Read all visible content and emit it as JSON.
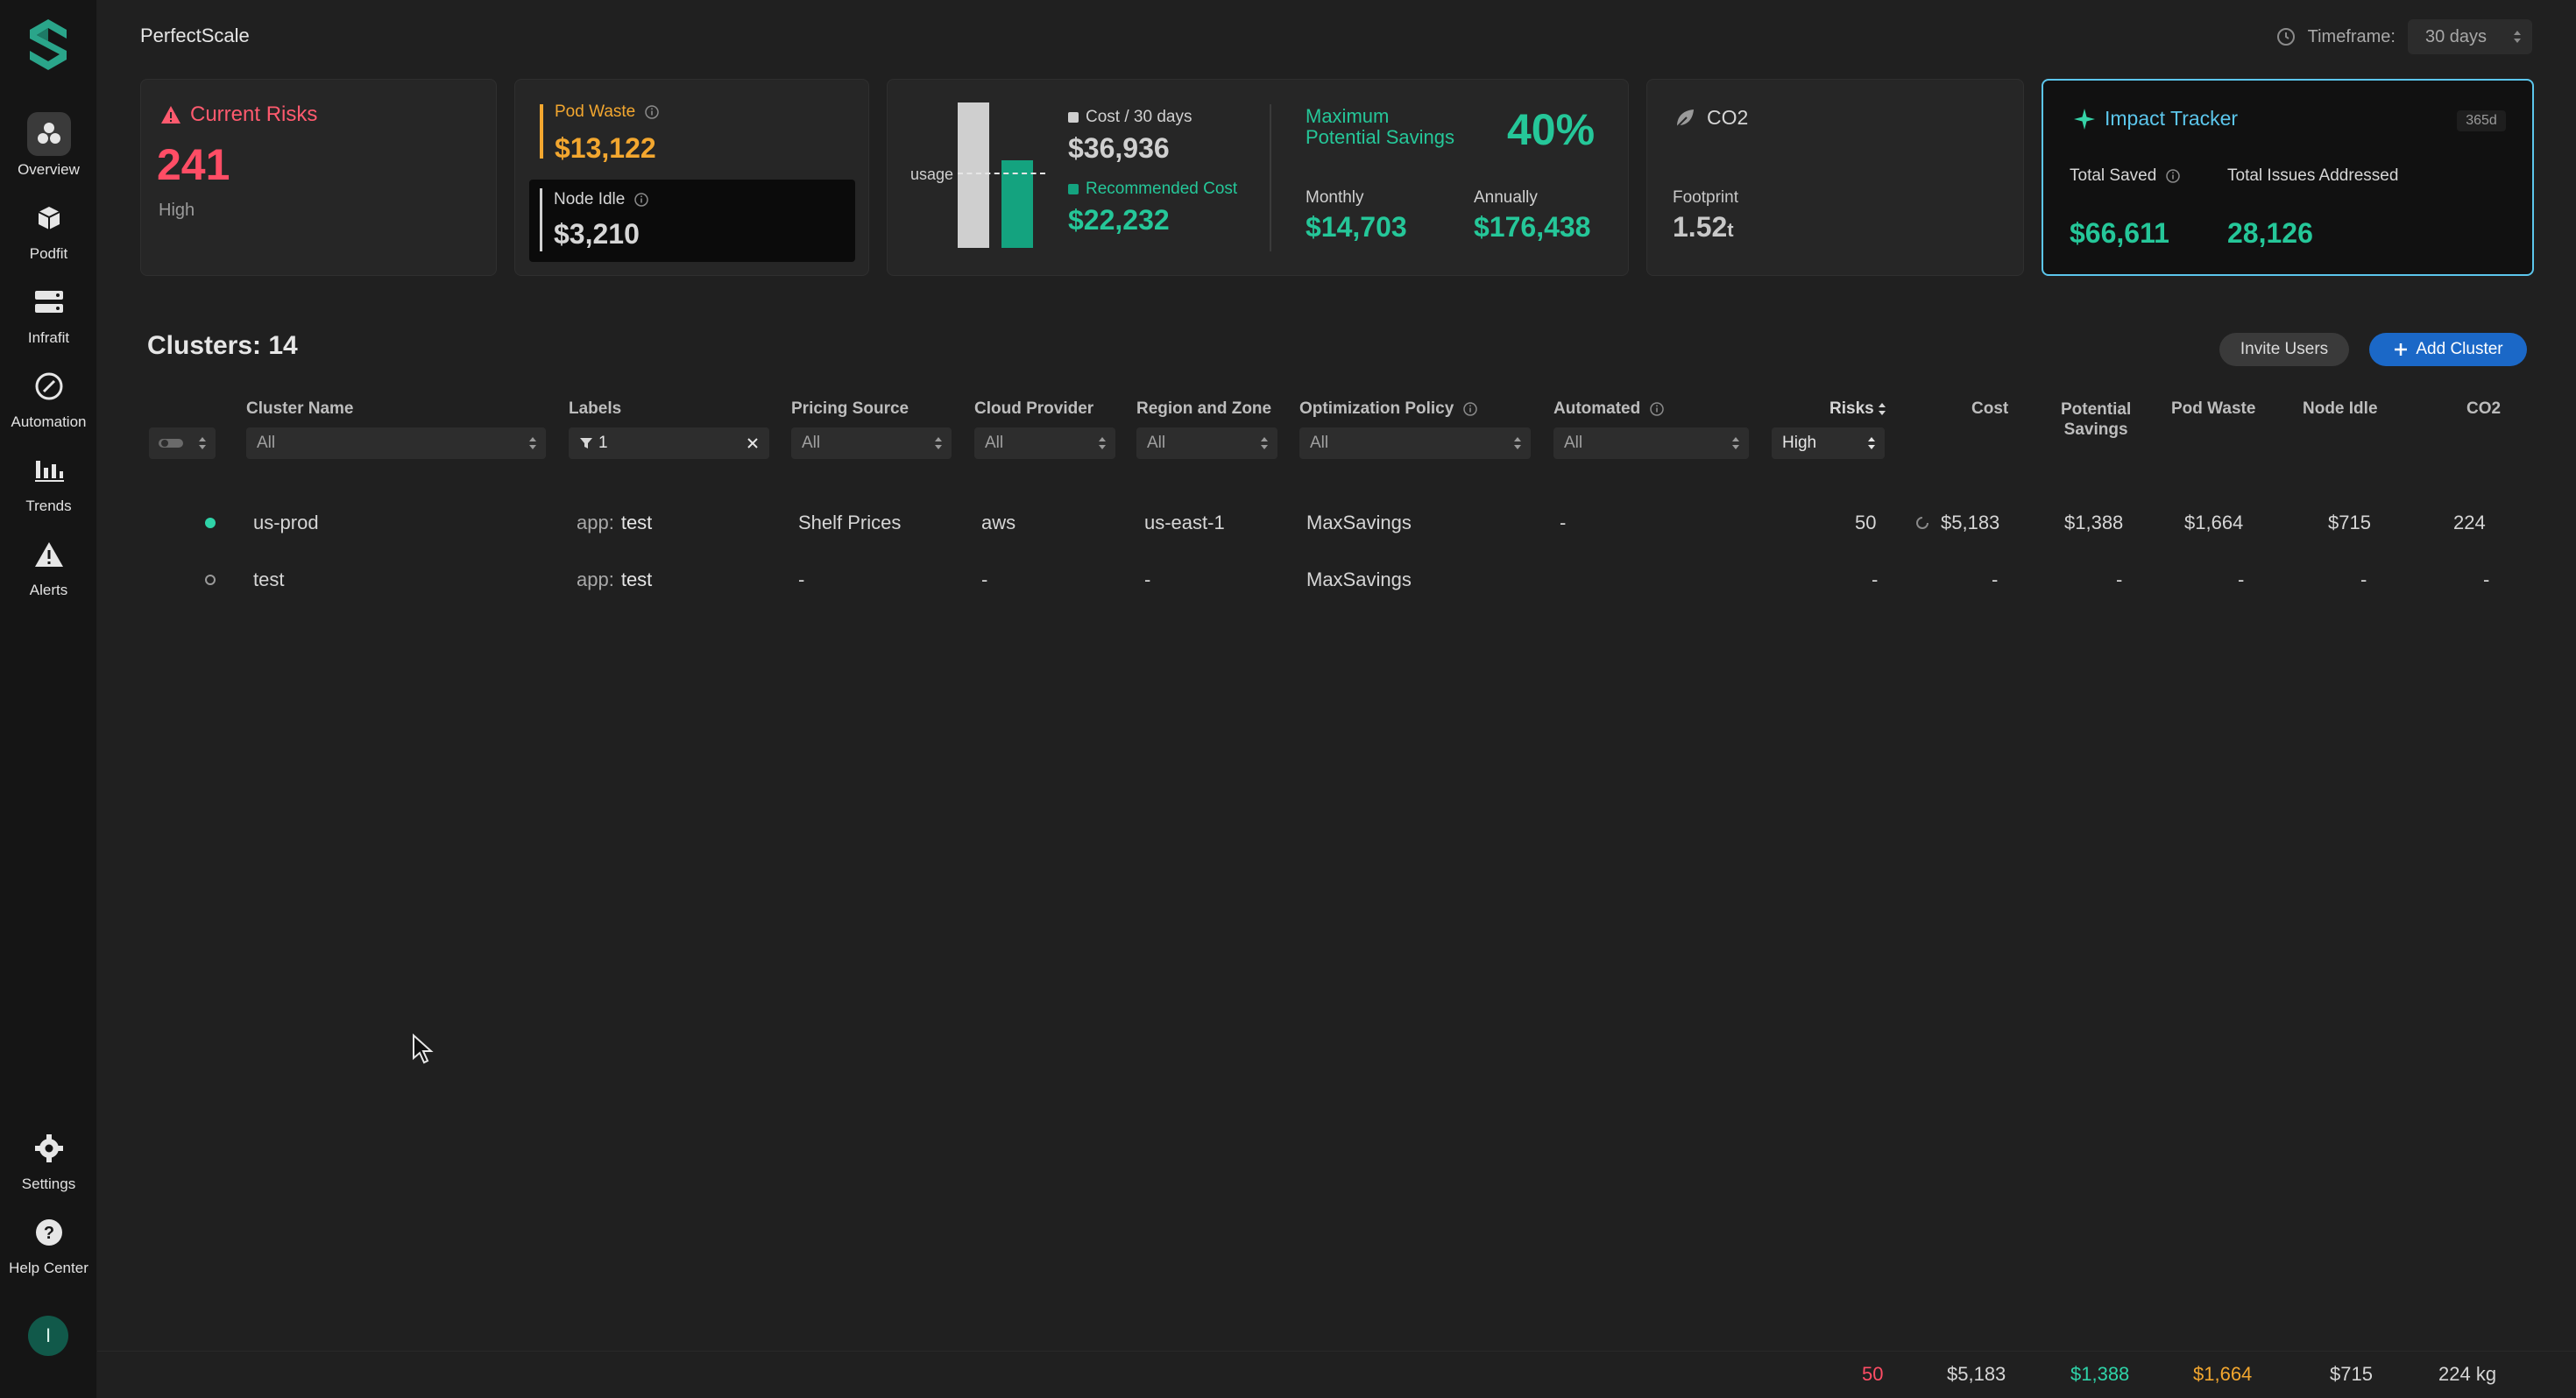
{
  "app": {
    "title": "PerfectScale"
  },
  "header": {
    "timeframe_label": "Timeframe:",
    "timeframe_value": "30 days"
  },
  "nav": {
    "overview": "Overview",
    "podfit": "Podfit",
    "infrafit": "Infrafit",
    "automation": "Automation",
    "trends": "Trends",
    "alerts": "Alerts",
    "settings": "Settings",
    "help": "Help Center",
    "avatar": "I"
  },
  "cards": {
    "risks": {
      "title": "Current Risks",
      "value": "241",
      "level": "High"
    },
    "waste": {
      "pod_waste_label": "Pod Waste",
      "pod_waste_value": "$13,122",
      "node_idle_label": "Node Idle",
      "node_idle_value": "$3,210"
    },
    "cost": {
      "usage_label": "usage",
      "cost_label": "Cost / 30 days",
      "cost_value": "$36,936",
      "rec_label": "Recommended Cost",
      "rec_value": "$22,232",
      "max_label_1": "Maximum",
      "max_label_2": "Potential Savings",
      "max_pct": "40%",
      "monthly_label": "Monthly",
      "monthly_value": "$14,703",
      "annually_label": "Annually",
      "annually_value": "$176,438"
    },
    "co2": {
      "title": "CO2",
      "footprint_label": "Footprint",
      "footprint_value": "1.52",
      "footprint_unit": "t"
    },
    "impact": {
      "title": "Impact Tracker",
      "badge": "365d",
      "saved_label": "Total Saved",
      "saved_value": "$66,611",
      "issues_label": "Total Issues Addressed",
      "issues_value": "28,126"
    }
  },
  "clusters": {
    "title": "Clusters: 14",
    "invite": "Invite Users",
    "add": "Add Cluster",
    "columns": {
      "name": "Cluster Name",
      "labels": "Labels",
      "pricing": "Pricing Source",
      "cloud": "Cloud Provider",
      "region": "Region and Zone",
      "policy": "Optimization Policy",
      "automated": "Automated",
      "risks": "Risks",
      "cost": "Cost",
      "potential_1": "Potential",
      "potential_2": "Savings",
      "pod_waste": "Pod Waste",
      "node_idle": "Node Idle",
      "co2": "CO2"
    },
    "filters": {
      "name": "All",
      "labels": "1",
      "pricing": "All",
      "cloud": "All",
      "region": "All",
      "policy": "All",
      "automated": "All",
      "risks": "High"
    },
    "rows": [
      {
        "name": "us-prod",
        "label_key": "app:",
        "label_val": "test",
        "pricing": "Shelf Prices",
        "cloud": "aws",
        "region": "us-east-1",
        "policy": "MaxSavings",
        "automated": "-",
        "risks": "50",
        "cost": "$5,183",
        "savings": "$1,388",
        "pod_waste": "$1,664",
        "node_idle": "$715",
        "co2": "224"
      },
      {
        "name": "test",
        "label_key": "app:",
        "label_val": "test",
        "pricing": "-",
        "cloud": "-",
        "region": "-",
        "policy": "MaxSavings",
        "automated": "",
        "risks": "-",
        "cost": "-",
        "savings": "-",
        "pod_waste": "-",
        "node_idle": "-",
        "co2": "-"
      }
    ],
    "totals": {
      "risks": "50",
      "cost": "$5,183",
      "savings": "$1,388",
      "pod_waste": "$1,664",
      "node_idle": "$715",
      "co2": "224 kg"
    }
  },
  "colors": {
    "accent_teal": "#2fd3a8",
    "brand_blue": "#1b68c7",
    "risk_red": "#ff4d65",
    "waste_orange": "#f3a72f",
    "impact_border": "#5cc6ec"
  }
}
